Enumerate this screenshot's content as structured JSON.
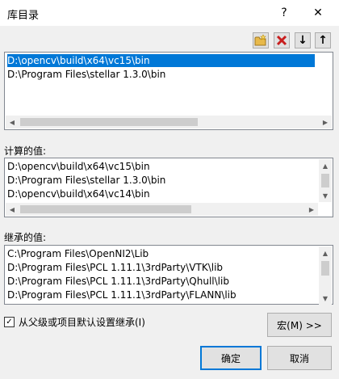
{
  "window": {
    "title": "库目录",
    "help_glyph": "?",
    "close_glyph": "✕"
  },
  "toolbar": {
    "new_icon": "folder-new-icon",
    "delete_icon": "delete-icon",
    "down_glyph": "↓",
    "up_glyph": "↑"
  },
  "edit_list": {
    "items": [
      "D:\\opencv\\build\\x64\\vc15\\bin",
      "D:\\Program Files\\stellar 1.3.0\\bin"
    ],
    "selected_index": 0
  },
  "computed": {
    "label": "计算的值:",
    "items": [
      "D:\\opencv\\build\\x64\\vc15\\bin",
      "D:\\Program Files\\stellar 1.3.0\\bin",
      "D:\\opencv\\build\\x64\\vc14\\bin"
    ]
  },
  "inherited": {
    "label": "继承的值:",
    "items": [
      "C:\\Program Files\\OpenNI2\\Lib",
      "D:\\Program Files\\PCL 1.11.1\\3rdParty\\VTK\\lib",
      "D:\\Program Files\\PCL 1.11.1\\3rdParty\\Qhull\\lib",
      "D:\\Program Files\\PCL 1.11.1\\3rdParty\\FLANN\\lib"
    ]
  },
  "inherit_checkbox": {
    "label": "从父级或项目默认设置继承(I)",
    "checked": true,
    "check_glyph": "✓"
  },
  "buttons": {
    "macro": "宏(M) >>",
    "ok": "确定",
    "cancel": "取消"
  },
  "colors": {
    "selection": "#0078d7",
    "delete_red": "#c81e1e"
  }
}
